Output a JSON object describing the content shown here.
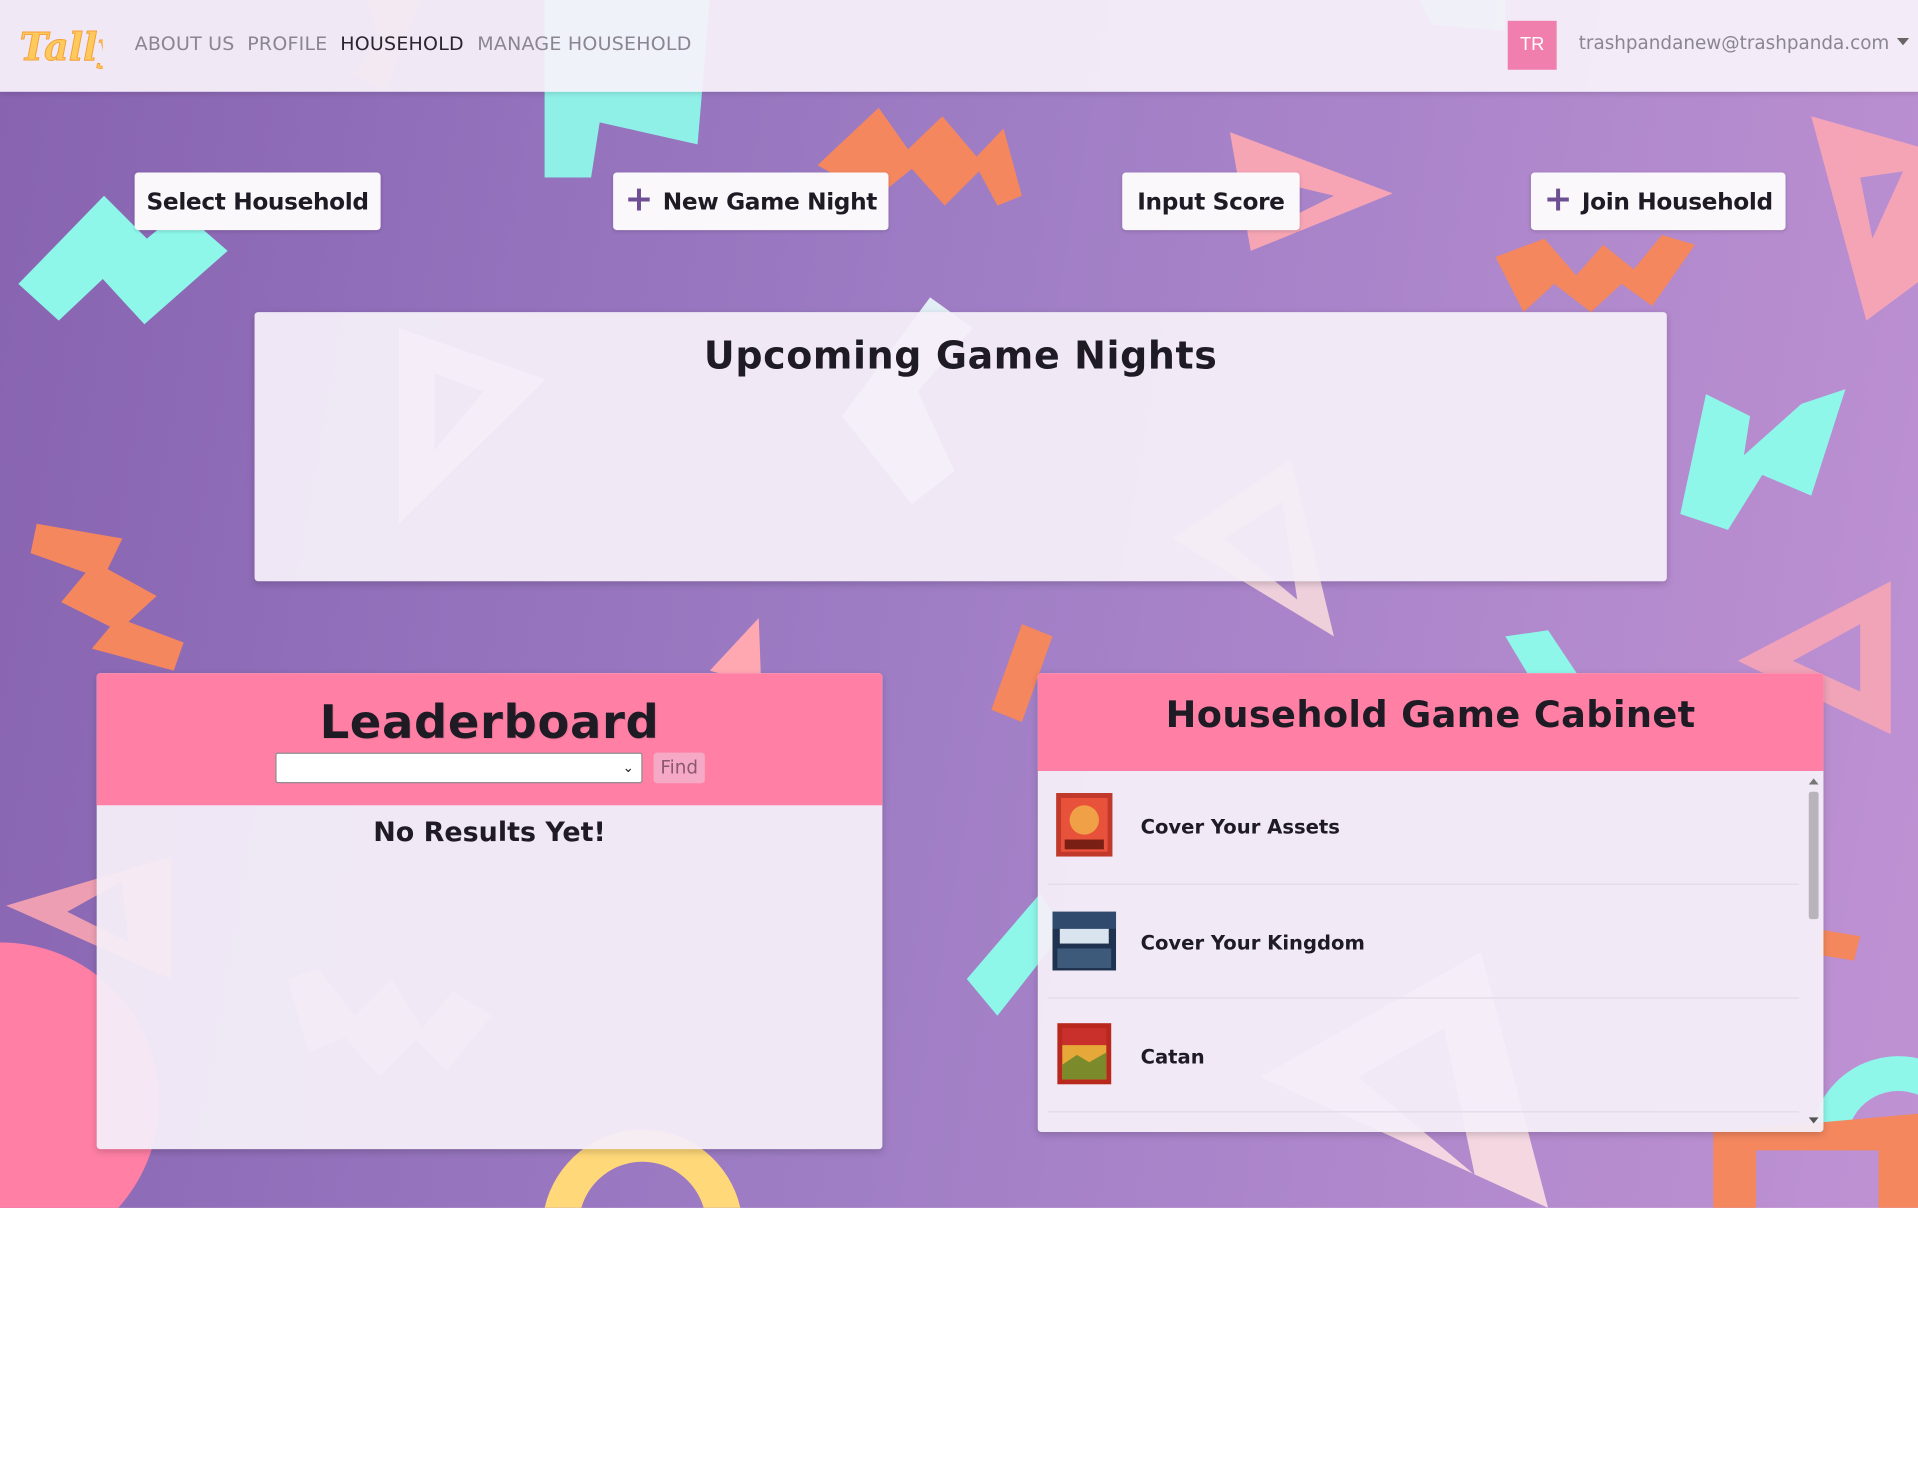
{
  "brand": {
    "logo_text": "Tally"
  },
  "nav": {
    "links": [
      {
        "label": "ABOUT US",
        "active": false
      },
      {
        "label": "PROFILE",
        "active": false
      },
      {
        "label": "HOUSEHOLD",
        "active": true
      },
      {
        "label": "MANAGE HOUSEHOLD",
        "active": false
      }
    ],
    "user": {
      "initials": "TR",
      "email": "trashpandanew@trashpanda.com"
    }
  },
  "actions": {
    "select_household": "Select Household",
    "new_game_night": "New Game Night",
    "input_score": "Input Score",
    "join_household": "Join Household"
  },
  "upcoming": {
    "title": "Upcoming Game Nights"
  },
  "leaderboard": {
    "title": "Leaderboard",
    "select_value": "",
    "find_label": "Find",
    "empty_text": "No Results Yet!"
  },
  "cabinet": {
    "title": "Household Game Cabinet",
    "games": [
      {
        "name": "Cover Your Assets",
        "thumb": "cover-your-assets-box"
      },
      {
        "name": "Cover Your Kingdom",
        "thumb": "cover-your-kingdom-box"
      },
      {
        "name": "Catan",
        "thumb": "catan-box"
      }
    ]
  },
  "colors": {
    "accent_pink": "#ff7fa5",
    "avatar_pink": "#f07fad",
    "plus_purple": "#6e4f93",
    "bg_purple": "#9d7cc4",
    "shape_cyan": "#8ef7ea",
    "shape_orange": "#f4875e"
  },
  "icons": [
    "plus-icon",
    "chevron-down-icon",
    "caret-down-icon"
  ]
}
